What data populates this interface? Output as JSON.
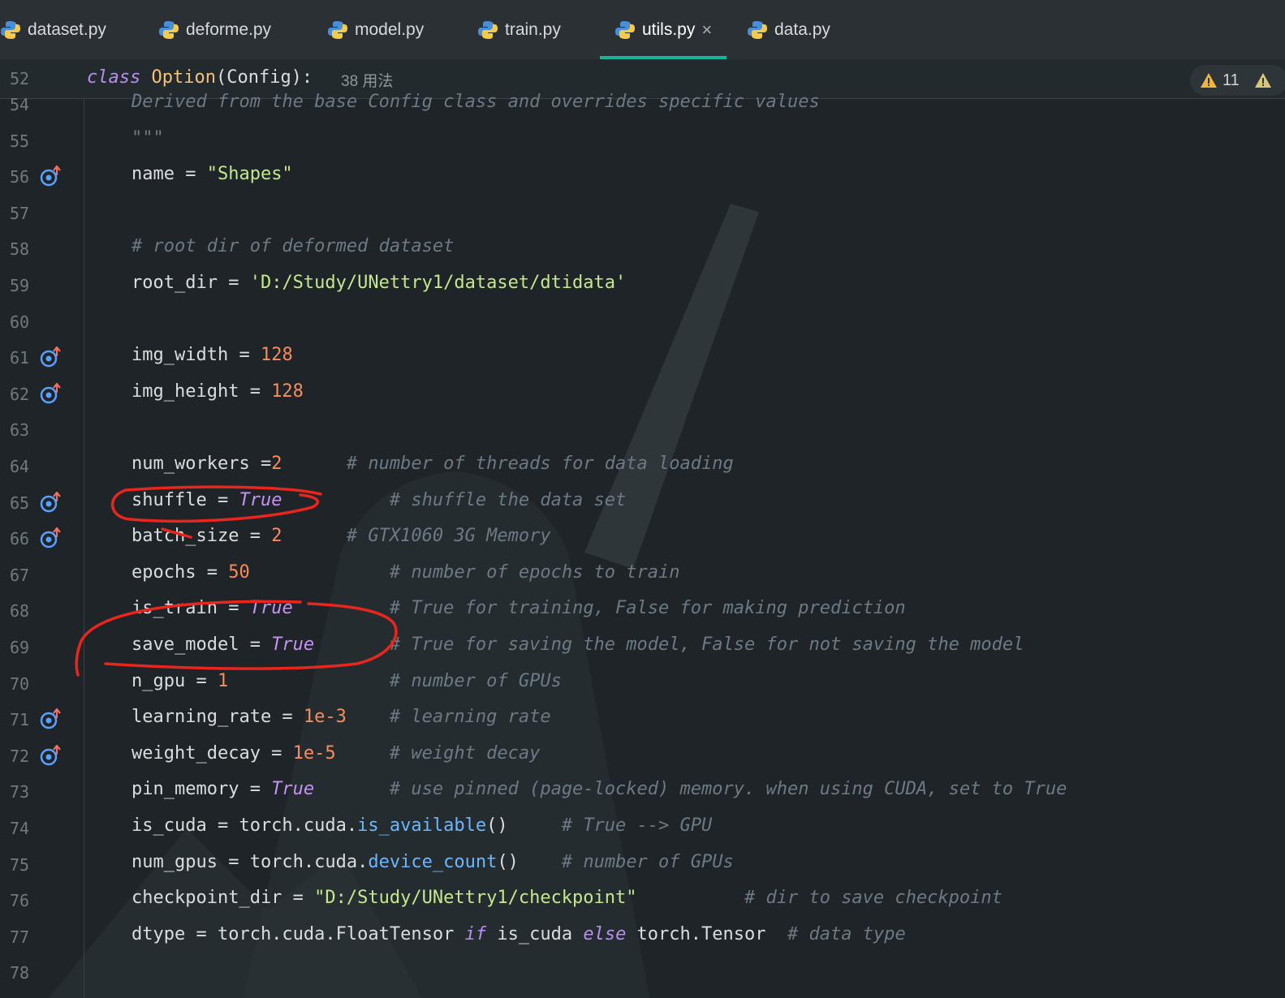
{
  "tabs": [
    {
      "label": "dataset.py",
      "active": false
    },
    {
      "label": "deforme.py",
      "active": false
    },
    {
      "label": "model.py",
      "active": false
    },
    {
      "label": "train.py",
      "active": false
    },
    {
      "label": "utils.py",
      "active": true,
      "close": "×"
    },
    {
      "label": "data.py",
      "active": false
    }
  ],
  "sticky": {
    "line_no": "52",
    "kw": "class",
    "name": "Option",
    "rest": "(Config):",
    "usages": "38 用法"
  },
  "warnings": {
    "count": "11"
  },
  "lines": [
    {
      "n": "54",
      "code": "Derived from the base Config class and overrides specific values"
    },
    {
      "n": "55",
      "code": "\"\"\""
    },
    {
      "n": "56",
      "code": "name = \"Shapes\""
    },
    {
      "n": "57",
      "code": ""
    },
    {
      "n": "58",
      "code": "# root dir of deformed dataset"
    },
    {
      "n": "59",
      "code": "root_dir = 'D:/Study/UNettry1/dataset/dtidata'"
    },
    {
      "n": "60",
      "code": ""
    },
    {
      "n": "61",
      "code": "img_width = 128"
    },
    {
      "n": "62",
      "code": "img_height = 128"
    },
    {
      "n": "63",
      "code": ""
    },
    {
      "n": "64",
      "code": "num_workers =2      # number of threads for data loading"
    },
    {
      "n": "65",
      "code": "shuffle = True          # shuffle the data set"
    },
    {
      "n": "66",
      "code": "batch_size = 2      # GTX1060 3G Memory"
    },
    {
      "n": "67",
      "code": "epochs = 50             # number of epochs to train"
    },
    {
      "n": "68",
      "code": "is_train = True         # True for training, False for making prediction"
    },
    {
      "n": "69",
      "code": "save_model = True       # True for saving the model, False for not saving the model"
    },
    {
      "n": "70",
      "code": "n_gpu = 1               # number of GPUs"
    },
    {
      "n": "71",
      "code": "learning_rate = 1e-3    # learning rate"
    },
    {
      "n": "72",
      "code": "weight_decay = 1e-5     # weight decay"
    },
    {
      "n": "73",
      "code": "pin_memory = True       # use pinned (page-locked) memory. when using CUDA, set to True"
    },
    {
      "n": "74",
      "code": "is_cuda = torch.cuda.is_available()     # True --> GPU"
    },
    {
      "n": "75",
      "code": "num_gpus = torch.cuda.device_count()    # number of GPUs"
    },
    {
      "n": "76",
      "code": "checkpoint_dir = \"D:/Study/UNettry1/checkpoint\"          # dir to save checkpoint"
    },
    {
      "n": "77",
      "code": "dtype = torch.cuda.FloatTensor if is_cuda else torch.Tensor  # data type"
    },
    {
      "n": "78",
      "code": ""
    }
  ],
  "override_marker_lines": [
    "56",
    "61",
    "62",
    "65",
    "66",
    "71",
    "72"
  ],
  "icons": {
    "tab": "python-icon",
    "gutter": "override-marker-icon",
    "warning": "warning-icon"
  },
  "colors": {
    "accent": "#18b49a",
    "annotation": "#e8261d"
  }
}
